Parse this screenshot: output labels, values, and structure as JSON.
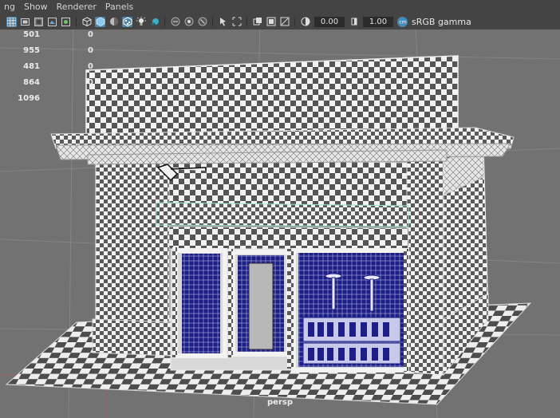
{
  "menu": [
    {
      "id": "view",
      "label": "ng"
    },
    {
      "id": "show",
      "label": "Show"
    },
    {
      "id": "renderer",
      "label": "Renderer"
    },
    {
      "id": "panels",
      "label": "Panels"
    }
  ],
  "toolbar": {
    "exposure_value": "0.00",
    "gamma_value": "1.00",
    "color_space_label": "sRGB gamma",
    "icons": [
      "grid-icon",
      "film-gate-icon",
      "resolution-gate-icon",
      "safe-area-icon",
      "xray-icon",
      "wireframe-icon",
      "smooth-shade-icon",
      "shade-wireframe-icon",
      "textured-icon",
      "lighting-icon",
      "shadows-icon",
      "ambient-occlusion-icon",
      "isolate-select-icon",
      "xray-joints-icon",
      "resolution-icon",
      "exposure-icon",
      "gamma-icon",
      "color-management-icon"
    ],
    "accent_color": "#5285a6"
  },
  "hud": {
    "rows": [
      {
        "v1": "501",
        "v2": "0"
      },
      {
        "v1": "955",
        "v2": "0"
      },
      {
        "v1": "481",
        "v2": "0"
      },
      {
        "v1": "864",
        "v2": "0"
      },
      {
        "v1": "1096",
        "v2": ""
      }
    ]
  },
  "camera_label": "persp",
  "viewport": {
    "background_color": "#727272",
    "grid_line_color": "#8a8a8a",
    "axis_color": "#a06060",
    "wireframe_color": "#1a1a8a",
    "selection_highlight_color": "#7fe0c8"
  }
}
